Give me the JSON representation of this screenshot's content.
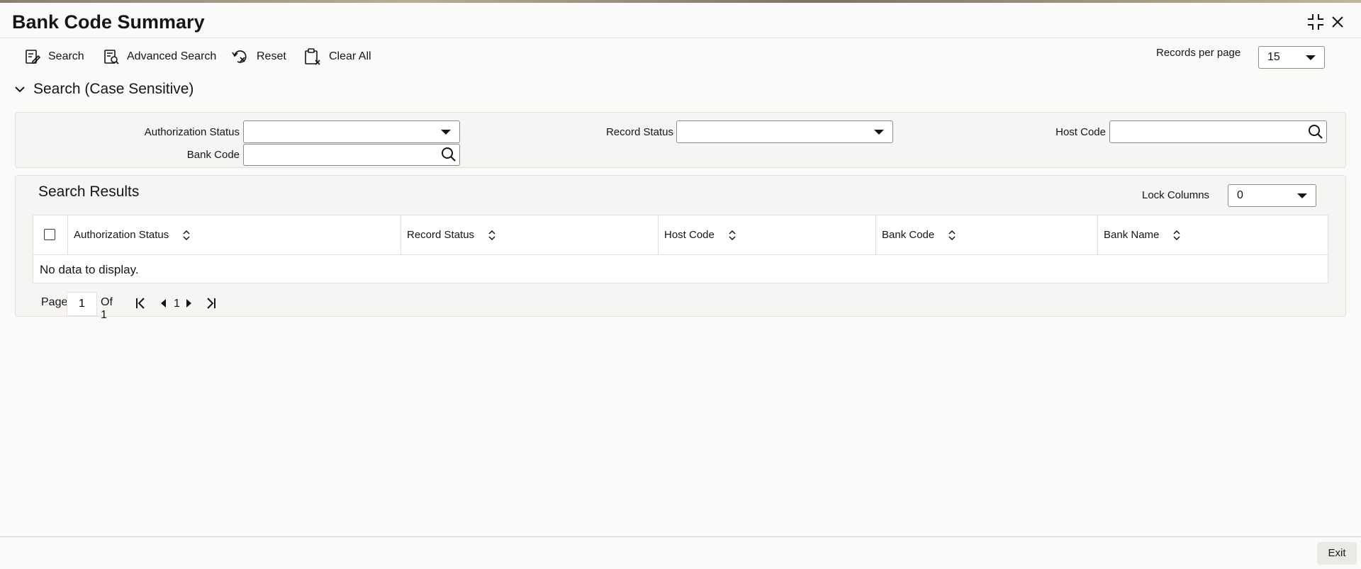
{
  "window": {
    "title": "Bank Code Summary"
  },
  "toolbar": {
    "search_label": "Search",
    "advanced_search_label": "Advanced Search",
    "reset_label": "Reset",
    "clear_all_label": "Clear All",
    "records_per_page_label": "Records per page",
    "records_per_page_value": "15"
  },
  "search_section": {
    "header": "Search (Case Sensitive)",
    "fields": {
      "authorization_status_label": "Authorization Status",
      "authorization_status_value": "",
      "record_status_label": "Record Status",
      "record_status_value": "",
      "host_code_label": "Host Code",
      "host_code_value": "",
      "bank_code_label": "Bank Code",
      "bank_code_value": ""
    }
  },
  "results": {
    "title": "Search Results",
    "lock_columns_label": "Lock Columns",
    "lock_columns_value": "0",
    "columns": [
      "Authorization Status",
      "Record Status",
      "Host Code",
      "Bank Code",
      "Bank Name"
    ],
    "empty_message": "No data to display."
  },
  "pagination": {
    "page_label": "Page",
    "page_value": "1",
    "of_label": "Of 1",
    "current_page": "1"
  },
  "footer": {
    "exit_label": "Exit"
  },
  "icons": {
    "maximize": "collapse-corners-icon",
    "close": "close-icon",
    "search": "search-form-icon",
    "advanced_search": "advanced-search-icon",
    "reset": "reset-icon",
    "clear_all": "clear-all-icon",
    "lov": "magnifier-icon",
    "sort": "sort-icon"
  },
  "colors": {
    "text": "#161513",
    "border": "#8e8a84",
    "panel": "#f6f5f3"
  }
}
